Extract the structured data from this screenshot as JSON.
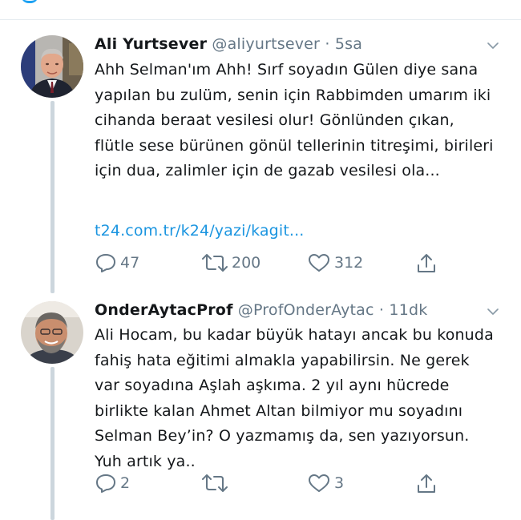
{
  "tweets": [
    {
      "name": "Ali Yurtsever",
      "handle": "@aliyurtsever",
      "separator": "·",
      "time": "5sa",
      "text": "Ahh Selman'ım Ahh! Sırf soyadın Gülen diye sana yapılan bu zulüm, senin için Rabbimden umarım iki cihanda beraat vesilesi olur! Gönlünden çıkan, flütle sese bürünen gönül tellerinin titreşimi, birileri için dua, zalimler için de gazab vesilesi ola...",
      "link": "t24.com.tr/k24/yazi/kagit...",
      "replies": "47",
      "retweets": "200",
      "likes": "312"
    },
    {
      "name": "OnderAytacProf",
      "handle": "@ProfOnderAytac",
      "separator": "·",
      "time": "11dk",
      "text": "Ali Hocam, bu kadar büyük hatayı ancak bu konuda fahiş hata eğitimi almakla yapabilirsin. Ne gerek var soyadına Aşlah aşkıma. 2 yıl aynı hücrede birlikte kalan Ahmet Altan bilmiyor mu soyadını Selman Bey’in? O yazmamış da, sen yazıyorsun. Yuh artık ya..",
      "replies": "2",
      "retweets": "",
      "likes": "3"
    }
  ],
  "icons": {
    "reply": "reply-icon",
    "retweet": "retweet-icon",
    "like": "heart-icon",
    "share": "share-icon",
    "caret": "chevron-down-icon"
  },
  "colors": {
    "text": "#14171a",
    "muted": "#657786",
    "link": "#1b95e0",
    "thread_line": "#ccd6dd",
    "accent": "#1da1f2"
  }
}
